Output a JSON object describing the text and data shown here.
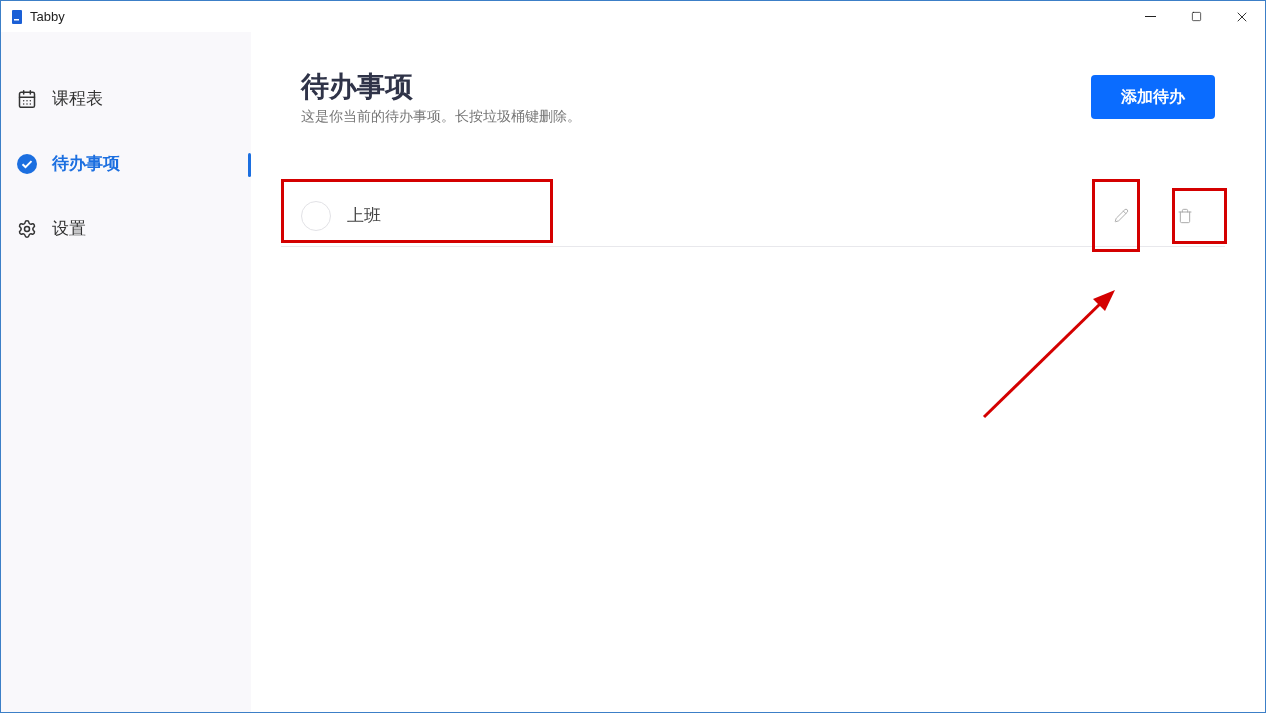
{
  "window": {
    "title": "Tabby"
  },
  "sidebar": {
    "items": [
      {
        "label": "课程表",
        "selected": false
      },
      {
        "label": "待办事项",
        "selected": true
      },
      {
        "label": "设置",
        "selected": false
      }
    ]
  },
  "page": {
    "title": "待办事项",
    "subtitle": "这是你当前的待办事项。长按垃圾桶键删除。",
    "add_button": "添加待办"
  },
  "todos": [
    {
      "text": "上班",
      "done": false
    }
  ]
}
